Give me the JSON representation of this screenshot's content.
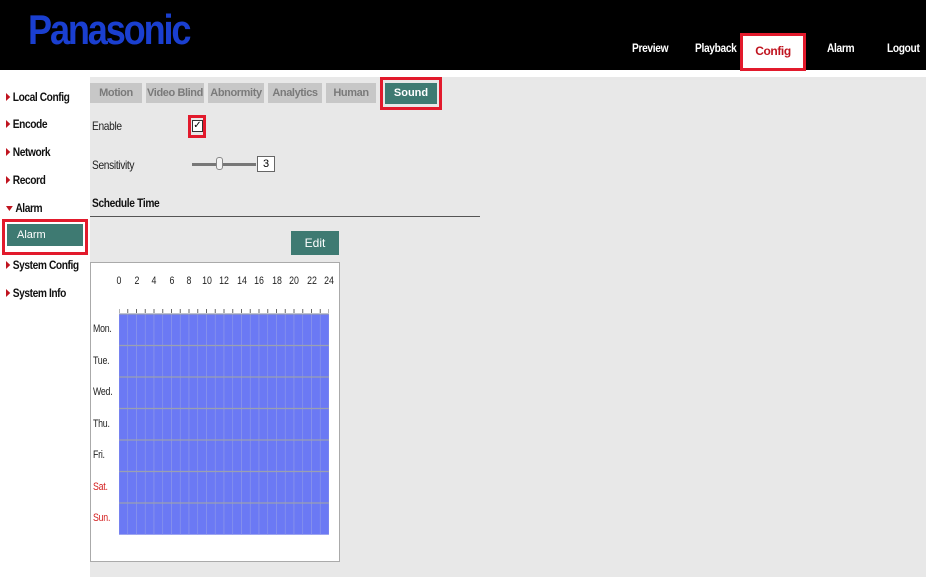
{
  "header": {
    "logo": "Panasonic",
    "nav": [
      "Preview",
      "Playback",
      "Config",
      "Alarm",
      "Logout"
    ],
    "active_nav": "Config"
  },
  "sidebar": {
    "items": [
      "Local Config",
      "Encode",
      "Network",
      "Record",
      "Alarm",
      "System Config",
      "System Info"
    ],
    "expanded": "Alarm",
    "sub_item": "Alarm"
  },
  "tabs": {
    "items": [
      "Motion",
      "Video Blind",
      "Abnormity",
      "Analytics",
      "Human",
      "Sound"
    ],
    "active": "Sound"
  },
  "form": {
    "enable_label": "Enable",
    "enable_checked": true,
    "enable_mark": "✓",
    "sensitivity_label": "Sensitivity",
    "sensitivity_value": "3",
    "schedule_title": "Schedule Time",
    "edit_label": "Edit"
  },
  "schedule": {
    "hours": [
      "0",
      "2",
      "4",
      "6",
      "8",
      "10",
      "12",
      "14",
      "16",
      "18",
      "20",
      "22",
      "24"
    ],
    "days": [
      "Mon.",
      "Tue.",
      "Wed.",
      "Thu.",
      "Fri.",
      "Sat.",
      "Sun."
    ],
    "weekend_days": [
      "Sat.",
      "Sun."
    ],
    "all_hours_selected": true
  },
  "colors": {
    "header_bg": "#000000",
    "logo": "#1a3fd0",
    "accent": "#3e7a72",
    "highlight_border": "#e21a2c",
    "weekend_text": "#d42020",
    "schedule_fill": "#6b79f4",
    "panel_bg": "#e8e8e8"
  }
}
